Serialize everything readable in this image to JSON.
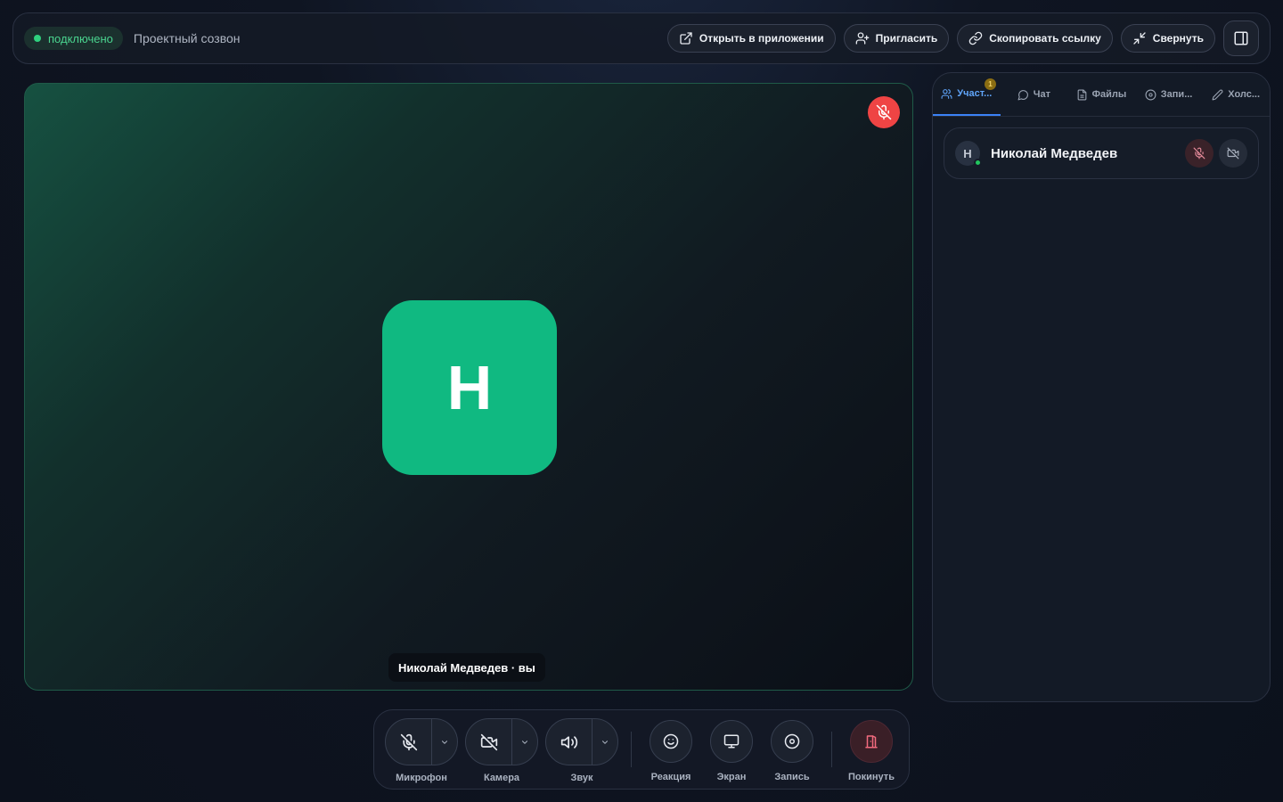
{
  "topbar": {
    "status": "подключено",
    "title": "Проектный созвон",
    "buttons": {
      "open_app": "Открыть в приложении",
      "invite": "Пригласить",
      "copy_link": "Скопировать ссылку",
      "minimize": "Свернуть"
    }
  },
  "video": {
    "avatar_letter": "Н",
    "name_tag": "Николай Медведев · вы"
  },
  "panel": {
    "tabs": [
      {
        "label": "Участ...",
        "badge": "1",
        "icon": "users-icon"
      },
      {
        "label": "Чат",
        "icon": "chat-icon"
      },
      {
        "label": "Файлы",
        "icon": "file-icon"
      },
      {
        "label": "Запи...",
        "icon": "record-icon"
      },
      {
        "label": "Холс...",
        "icon": "pencil-icon"
      }
    ],
    "participants": [
      {
        "initial": "Н",
        "name": "Николай Медведев"
      }
    ]
  },
  "controls": {
    "microphone": "Микрофон",
    "camera": "Камера",
    "sound": "Звук",
    "reaction": "Реакция",
    "screen": "Экран",
    "record": "Запись",
    "leave": "Покинуть"
  },
  "colors": {
    "accent_green": "#10b981",
    "status_green": "#2fd07e",
    "danger_red": "#ef4444",
    "tab_active_blue": "#3b82f6"
  }
}
